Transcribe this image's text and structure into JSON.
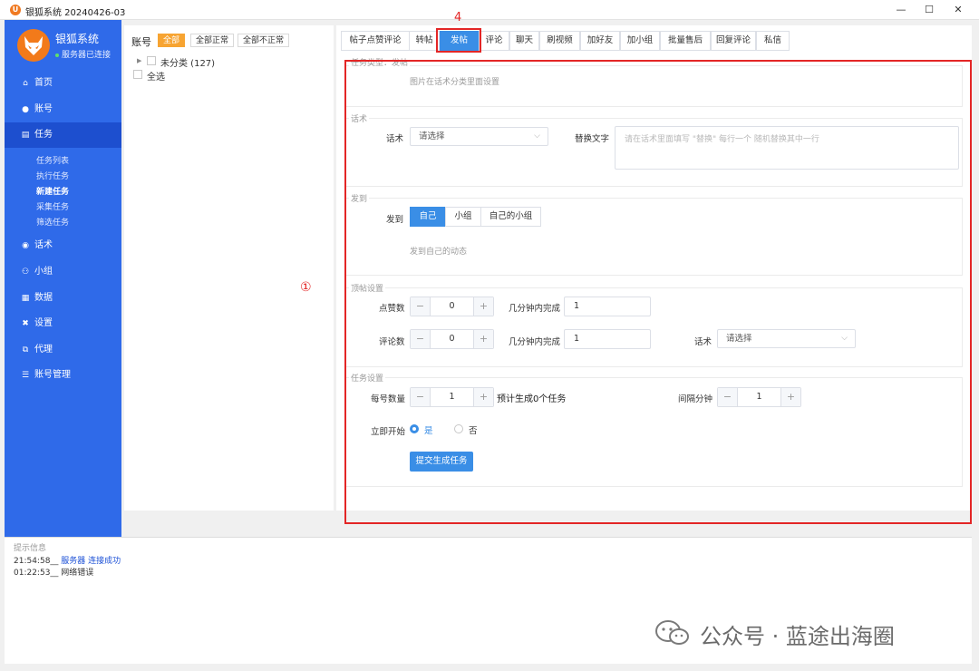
{
  "window": {
    "title": "银狐系统 20240426-03",
    "app_icon_letter": "U",
    "controls": {
      "minimize": "—",
      "maximize": "☐",
      "close": "✕"
    }
  },
  "sidebar": {
    "brand": "银狐系统",
    "server_status": "服务器已连接",
    "items": [
      {
        "label": "首页",
        "icon": "home-icon"
      },
      {
        "label": "账号",
        "icon": "user-icon"
      },
      {
        "label": "任务",
        "icon": "task-icon",
        "active": true
      },
      {
        "label": "话术",
        "icon": "chat-icon"
      },
      {
        "label": "小组",
        "icon": "group-icon"
      },
      {
        "label": "数据",
        "icon": "data-icon"
      },
      {
        "label": "设置",
        "icon": "settings-icon"
      },
      {
        "label": "代理",
        "icon": "proxy-icon"
      },
      {
        "label": "账号管理",
        "icon": "database-icon"
      }
    ],
    "task_sub": [
      "任务列表",
      "执行任务",
      "新建任务",
      "采集任务",
      "筛选任务"
    ],
    "task_sub_active": "新建任务"
  },
  "accounts": {
    "label": "账号",
    "filters": [
      "全部",
      "全部正常",
      "全部不正常"
    ],
    "active_filter": "全部",
    "tree_node": "未分类 (127)",
    "select_all": "全选"
  },
  "tabs": {
    "items": [
      "帖子点赞评论",
      "转帖",
      "发帖",
      "评论",
      "聊天",
      "刷视频",
      "加好友",
      "加小组",
      "批量售后",
      "回复评论",
      "私信"
    ],
    "active": "发帖"
  },
  "annotations": {
    "tab_marker": "4",
    "area_marker": "①"
  },
  "form": {
    "type_section": {
      "legend": "任务类型：发帖",
      "hint": "图片在话术分类里面设置"
    },
    "speech_section": {
      "legend": "话术",
      "speech_label": "话术",
      "speech_select": "请选择",
      "replace_label": "替换文字",
      "replace_placeholder": "请在话术里面填写 \"替换\" 每行一个 随机替换其中一行"
    },
    "post_to_section": {
      "legend": "发到",
      "label": "发到",
      "options": [
        "自己",
        "小组",
        "自己的小组"
      ],
      "active": "自己",
      "hint": "发到自己的动态"
    },
    "top_section": {
      "legend": "顶帖设置",
      "like_label": "点赞数",
      "like_value": "0",
      "like_minutes_label": "几分钟内完成",
      "like_minutes_value": "1",
      "comment_label": "评论数",
      "comment_value": "0",
      "comment_minutes_label": "几分钟内完成",
      "comment_minutes_value": "1",
      "speech_label": "话术",
      "speech_select": "请选择"
    },
    "task_section": {
      "legend": "任务设置",
      "per_account_label": "每号数量",
      "per_account_value": "1",
      "estimate": "预计生成0个任务",
      "interval_label": "间隔分钟",
      "interval_value": "1",
      "start_now_label": "立即开始",
      "yes": "是",
      "no": "否",
      "start_now": "是",
      "submit": "提交生成任务"
    }
  },
  "log": {
    "title": "提示信息",
    "lines": [
      {
        "time": "21:54:58__",
        "text": "服务器 连接成功",
        "highlight": true
      },
      {
        "time": "01:22:53__",
        "text": "网络错误",
        "highlight": false
      }
    ]
  },
  "watermark": {
    "text": "公众号 · 蓝途出海圈"
  }
}
